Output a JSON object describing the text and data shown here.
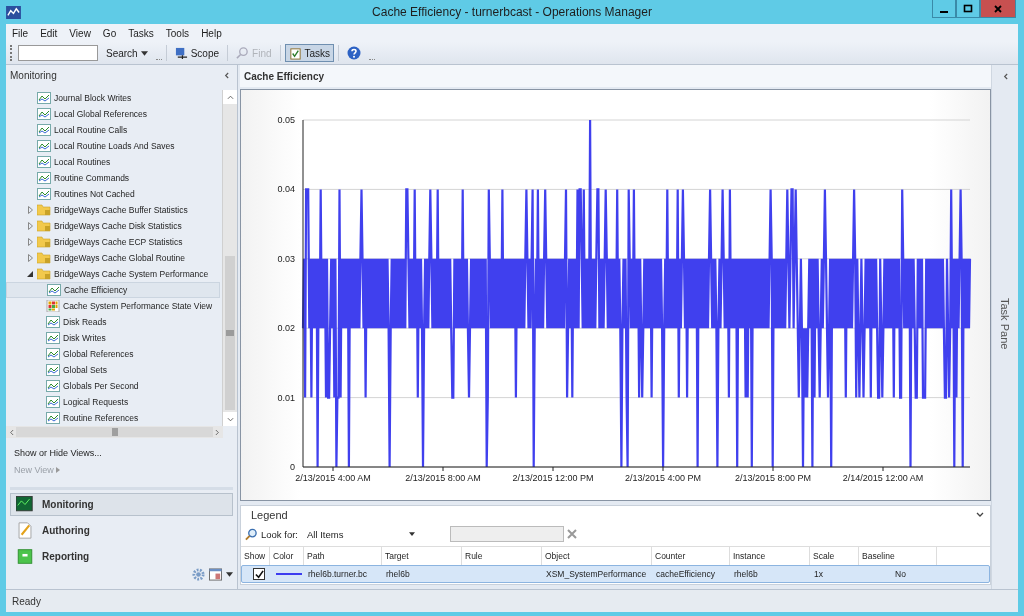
{
  "window": {
    "title": "Cache Efficiency - turnerbcast - Operations Manager"
  },
  "menu": [
    "File",
    "Edit",
    "View",
    "Go",
    "Tasks",
    "Tools",
    "Help"
  ],
  "toolbar": [
    {
      "kind": "search",
      "label": "Search"
    },
    {
      "kind": "scope",
      "label": "Scope",
      "disabled": false,
      "pressed": false
    },
    {
      "kind": "find",
      "label": "Find",
      "disabled": true,
      "pressed": false
    },
    {
      "kind": "tasks",
      "label": "Tasks",
      "disabled": false,
      "pressed": true
    },
    {
      "kind": "help"
    }
  ],
  "sidebar": {
    "title": "Monitoring",
    "tree": [
      {
        "kind": "view",
        "label": "Journal Block Writes",
        "selected": false
      },
      {
        "kind": "view",
        "label": "Local Global References",
        "selected": false
      },
      {
        "kind": "view",
        "label": "Local Routine Calls",
        "selected": false
      },
      {
        "kind": "view",
        "label": "Local Routine Loads And Saves",
        "selected": false
      },
      {
        "kind": "view",
        "label": "Local Routines",
        "selected": false
      },
      {
        "kind": "view",
        "label": "Routine Commands",
        "selected": false
      },
      {
        "kind": "view",
        "label": "Routines Not Cached",
        "selected": false
      },
      {
        "kind": "folder",
        "label": "BridgeWays Cache Buffer Statistics",
        "selected": false,
        "expanded": false
      },
      {
        "kind": "folder",
        "label": "BridgeWays Cache Disk Statistics",
        "selected": false,
        "expanded": false
      },
      {
        "kind": "folder",
        "label": "BridgeWays Cache ECP Statistics",
        "selected": false,
        "expanded": false
      },
      {
        "kind": "folder",
        "label": "BridgeWays Cache Global Routine",
        "selected": false,
        "expanded": false
      },
      {
        "kind": "folder",
        "label": "BridgeWays Cache System Performance",
        "selected": false,
        "expanded": true,
        "children": [
          {
            "kind": "view",
            "label": "Cache Efficiency",
            "selected": true
          },
          {
            "kind": "state",
            "label": "Cache System Performance State View",
            "selected": false
          },
          {
            "kind": "view",
            "label": "Disk Reads",
            "selected": false
          },
          {
            "kind": "view",
            "label": "Disk Writes",
            "selected": false
          },
          {
            "kind": "view",
            "label": "Global References",
            "selected": false
          },
          {
            "kind": "view",
            "label": "Global Sets",
            "selected": false
          },
          {
            "kind": "view",
            "label": "Globals Per Second",
            "selected": false
          },
          {
            "kind": "view",
            "label": "Logical Requests",
            "selected": false
          },
          {
            "kind": "view",
            "label": "Routine References",
            "selected": false
          }
        ]
      }
    ],
    "links": [
      {
        "label": "Show or Hide Views...",
        "disabled": false
      },
      {
        "label": "New View",
        "disabled": true
      }
    ],
    "sections": [
      {
        "kind": "monitoring",
        "label": "Monitoring",
        "selected": true
      },
      {
        "kind": "authoring",
        "label": "Authoring",
        "selected": false
      },
      {
        "kind": "reporting",
        "label": "Reporting",
        "selected": false
      }
    ]
  },
  "view": {
    "title": "Cache Efficiency",
    "y_axis_labels": [
      "0.05",
      "0.04",
      "0.03",
      "0.02",
      "0.01",
      "0"
    ],
    "x_axis_labels": [
      "2/13/2015 4:00 AM",
      "2/13/2015 8:00 AM",
      "2/13/2015 12:00 PM",
      "2/13/2015 4:00 PM",
      "2/13/2015 8:00 PM",
      "2/14/2015 12:00 AM"
    ]
  },
  "legend": {
    "title": "Legend",
    "look_for_label": "Look for:",
    "look_for_value": "All Items",
    "columns": [
      "Show",
      "Color",
      "Path",
      "Target",
      "Rule",
      "Object",
      "Counter",
      "Instance",
      "Scale",
      "Baseline"
    ],
    "rows": [
      {
        "show": true,
        "color": "#3c3cf0",
        "selected": true,
        "cells": [
          "",
          "",
          "rhel6b.turner.bc",
          "rhel6b",
          "",
          "XSM_SystemPerformance",
          "cacheEfficiency",
          "rhel6b",
          "1x",
          "No"
        ]
      }
    ]
  },
  "task_pane": {
    "title": "Task Pane"
  },
  "status_bar": "Ready"
}
